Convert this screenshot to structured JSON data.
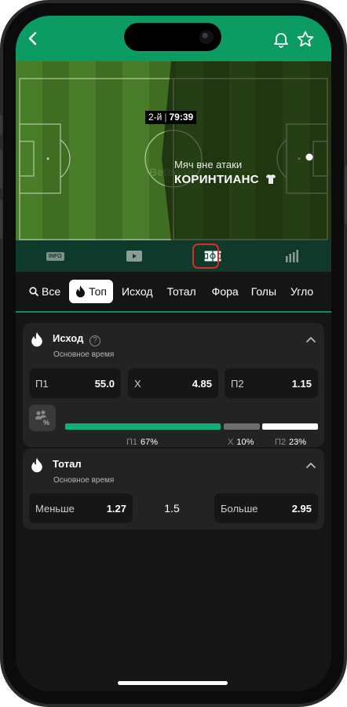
{
  "colors": {
    "header": "#0c9b63",
    "toolbar": "#0f3a2b",
    "card": "#232323",
    "accent_green": "#10b07a",
    "highlight_red": "#e0282b"
  },
  "header": {
    "back_icon": "chevron-left-icon",
    "bell_icon": "bell-icon",
    "star_icon": "star-icon"
  },
  "match": {
    "period": "2-й",
    "time": "79:39",
    "status": "Мяч вне атаки",
    "team": "КОРИНТИАНС"
  },
  "toolbar": {
    "info_label": "INFO",
    "icons": [
      "info-icon",
      "video-play-icon",
      "field-scheme-icon",
      "stats-bars-icon"
    ],
    "highlighted": "field-scheme-icon"
  },
  "filters": {
    "all": "Все",
    "top": "Топ",
    "items": [
      "Исход",
      "Тотал",
      "Фора",
      "Голы",
      "Угло"
    ]
  },
  "outcome": {
    "title": "Исход",
    "subtitle": "Основное время",
    "odds": [
      {
        "label": "П1",
        "value": "55.0"
      },
      {
        "label": "Х",
        "value": "4.85"
      },
      {
        "label": "П2",
        "value": "1.15"
      }
    ],
    "percentages": [
      {
        "label": "П1",
        "value": "67%",
        "share": 0.67
      },
      {
        "label": "Х",
        "value": "10%",
        "share": 0.1
      },
      {
        "label": "П2",
        "value": "23%",
        "share": 0.23
      }
    ]
  },
  "total": {
    "title": "Тотал",
    "subtitle": "Основное время",
    "under_label": "Меньше",
    "under_value": "1.27",
    "line": "1.5",
    "over_label": "Больше",
    "over_value": "2.95"
  }
}
